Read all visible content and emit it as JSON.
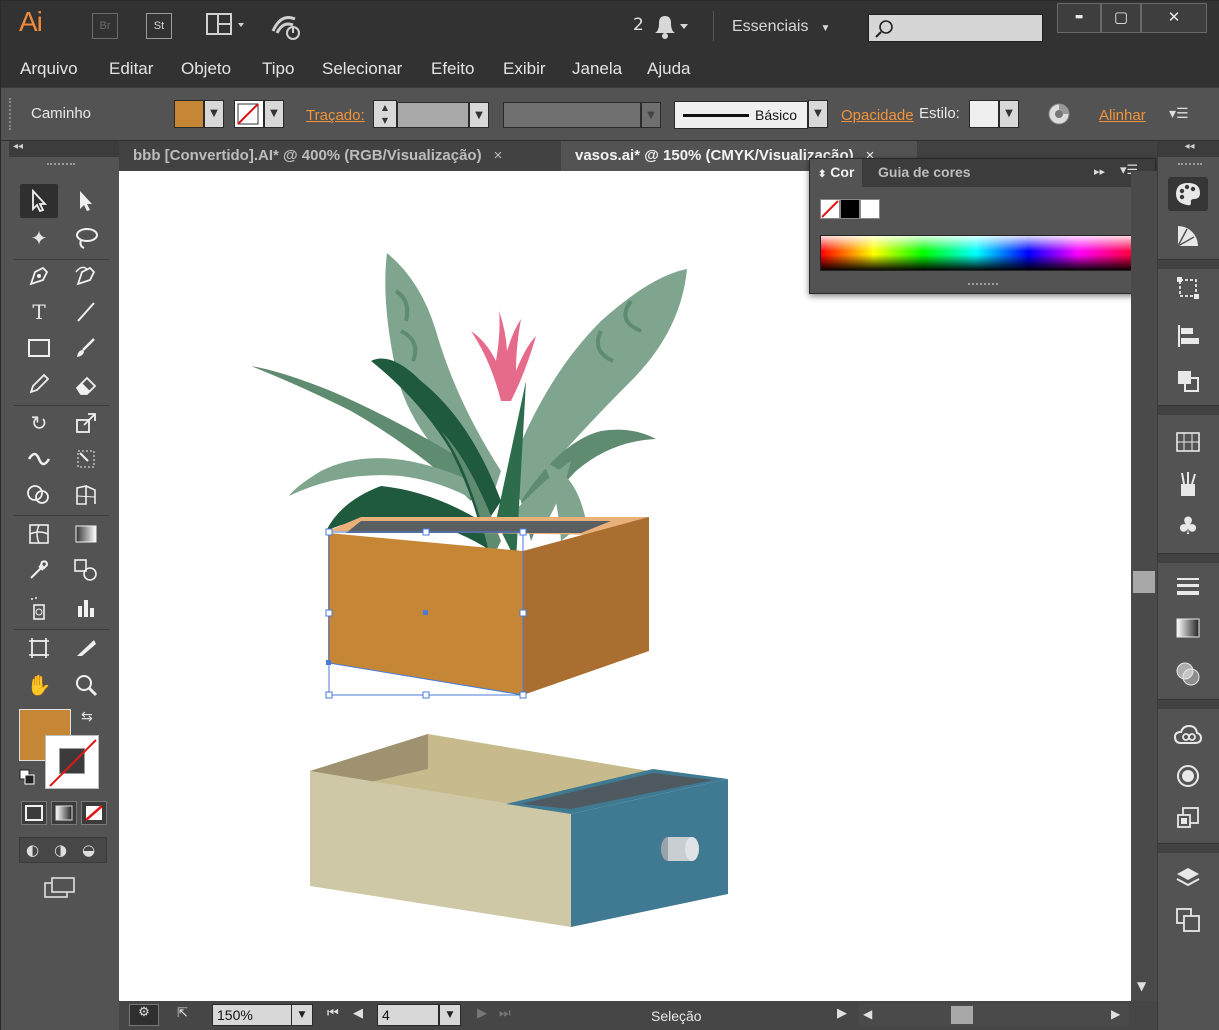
{
  "app": {
    "logo": "Ai",
    "bridge": "Br",
    "stock": "St",
    "notifications_count": "2",
    "workspace": "Essenciais",
    "search_placeholder": ""
  },
  "window_controls": {
    "minimize": "▬",
    "maximize": "▢",
    "close": "✕"
  },
  "menu": [
    "Arquivo",
    "Editar",
    "Objeto",
    "Tipo",
    "Selecionar",
    "Efeito",
    "Exibir",
    "Janela",
    "Ajuda"
  ],
  "control_bar": {
    "selection_type": "Caminho",
    "fill_color": "#c58736",
    "stroke_label": "Traçado:",
    "stroke_style": "Básico",
    "opacity_label": "Opacidade",
    "style_label": "Estilo:",
    "align_label": "Alinhar"
  },
  "tabs": [
    {
      "label": "bbb [Convertido].AI* @ 400% (RGB/Visualização)",
      "close": "×"
    },
    {
      "label": "vasos.ai* @ 150% (CMYK/Visualização)",
      "close": "×"
    }
  ],
  "color_panel": {
    "tab_active": "Cor",
    "tab_inactive": "Guia de cores"
  },
  "status": {
    "zoom": "150%",
    "artboard": "4",
    "tool": "Seleção"
  },
  "colors": {
    "accent": "#f0943c",
    "fill": "#c58736",
    "planter_side": "#a96e30",
    "drawer_body": "#cfc8a6",
    "drawer_front": "#3f7a92",
    "leaf_dark": "#1f5a3f",
    "leaf_light": "#7fa58f",
    "flower": "#e66a8a",
    "selection": "#4a7bd8"
  }
}
